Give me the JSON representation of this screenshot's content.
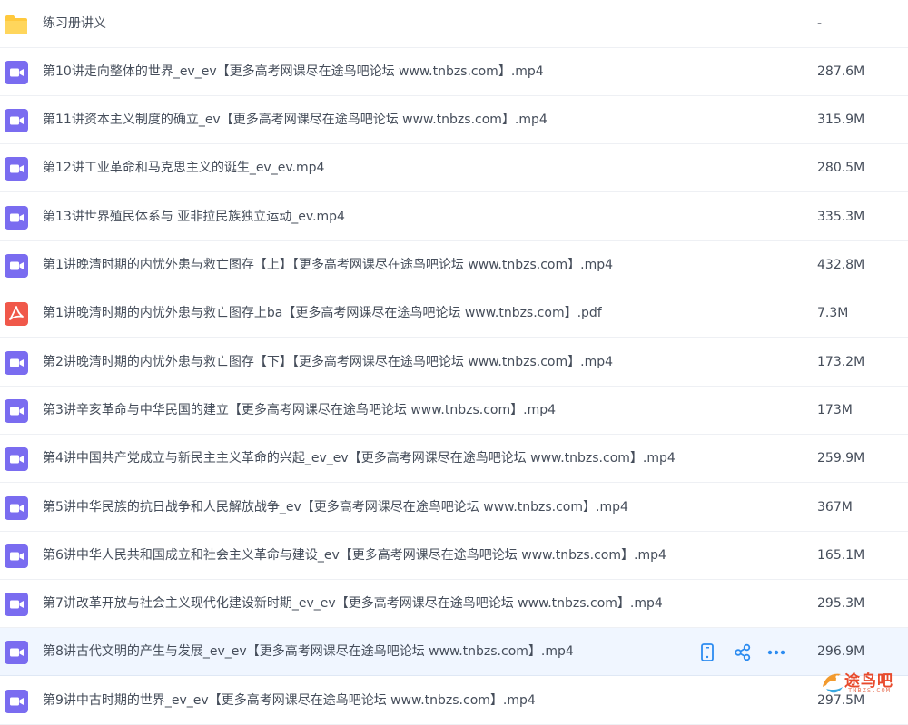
{
  "files": [
    {
      "name": "练习册讲义",
      "size": "-",
      "type": "folder"
    },
    {
      "name": "第10讲走向整体的世界_ev_ev【更多高考网课尽在途鸟吧论坛 www.tnbzs.com】.mp4",
      "size": "287.6M",
      "type": "video"
    },
    {
      "name": "第11讲资本主义制度的确立_ev【更多高考网课尽在途鸟吧论坛 www.tnbzs.com】.mp4",
      "size": "315.9M",
      "type": "video"
    },
    {
      "name": "第12讲工业革命和马克思主义的诞生_ev_ev.mp4",
      "size": "280.5M",
      "type": "video"
    },
    {
      "name": "第13讲世界殖民体系与 亚非拉民族独立运动_ev.mp4",
      "size": "335.3M",
      "type": "video"
    },
    {
      "name": "第1讲晚清时期的内忧外患与救亡图存【上】【更多高考网课尽在途鸟吧论坛 www.tnbzs.com】.mp4",
      "size": "432.8M",
      "type": "video"
    },
    {
      "name": "第1讲晚清时期的内忧外患与救亡图存上ba【更多高考网课尽在途鸟吧论坛 www.tnbzs.com】.pdf",
      "size": "7.3M",
      "type": "pdf"
    },
    {
      "name": "第2讲晚清时期的内忧外患与救亡图存【下】【更多高考网课尽在途鸟吧论坛 www.tnbzs.com】.mp4",
      "size": "173.2M",
      "type": "video"
    },
    {
      "name": "第3讲辛亥革命与中华民国的建立【更多高考网课尽在途鸟吧论坛 www.tnbzs.com】.mp4",
      "size": "173M",
      "type": "video"
    },
    {
      "name": "第4讲中国共产党成立与新民主主义革命的兴起_ev_ev【更多高考网课尽在途鸟吧论坛 www.tnbzs.com】.mp4",
      "size": "259.9M",
      "type": "video"
    },
    {
      "name": "第5讲中华民族的抗日战争和人民解放战争_ev【更多高考网课尽在途鸟吧论坛 www.tnbzs.com】.mp4",
      "size": "367M",
      "type": "video"
    },
    {
      "name": "第6讲中华人民共和国成立和社会主义革命与建设_ev【更多高考网课尽在途鸟吧论坛 www.tnbzs.com】.mp4",
      "size": "165.1M",
      "type": "video"
    },
    {
      "name": "第7讲改革开放与社会主义现代化建设新时期_ev_ev【更多高考网课尽在途鸟吧论坛 www.tnbzs.com】.mp4",
      "size": "295.3M",
      "type": "video"
    },
    {
      "name": "第8讲古代文明的产生与发展_ev_ev【更多高考网课尽在途鸟吧论坛 www.tnbzs.com】.mp4",
      "size": "296.9M",
      "type": "video",
      "highlighted": true
    },
    {
      "name": "第9讲中古时期的世界_ev_ev【更多高考网课尽在途鸟吧论坛 www.tnbzs.com】.mp4",
      "size": "297.5M",
      "type": "video"
    }
  ],
  "row_actions": [
    {
      "icon": "phone-icon",
      "label": "phone"
    },
    {
      "icon": "share-icon",
      "label": "share"
    },
    {
      "icon": "more-icon",
      "label": "more"
    }
  ],
  "watermark": {
    "text": "途鸟吧",
    "sub": "TNBZS.COM"
  },
  "colors": {
    "video_icon": "#7a6cf0",
    "pdf_icon": "#f0584a",
    "folder_icon": "#ffc93d",
    "action_icon": "#2d8cf0",
    "highlight_row": "#f0f6ff"
  }
}
